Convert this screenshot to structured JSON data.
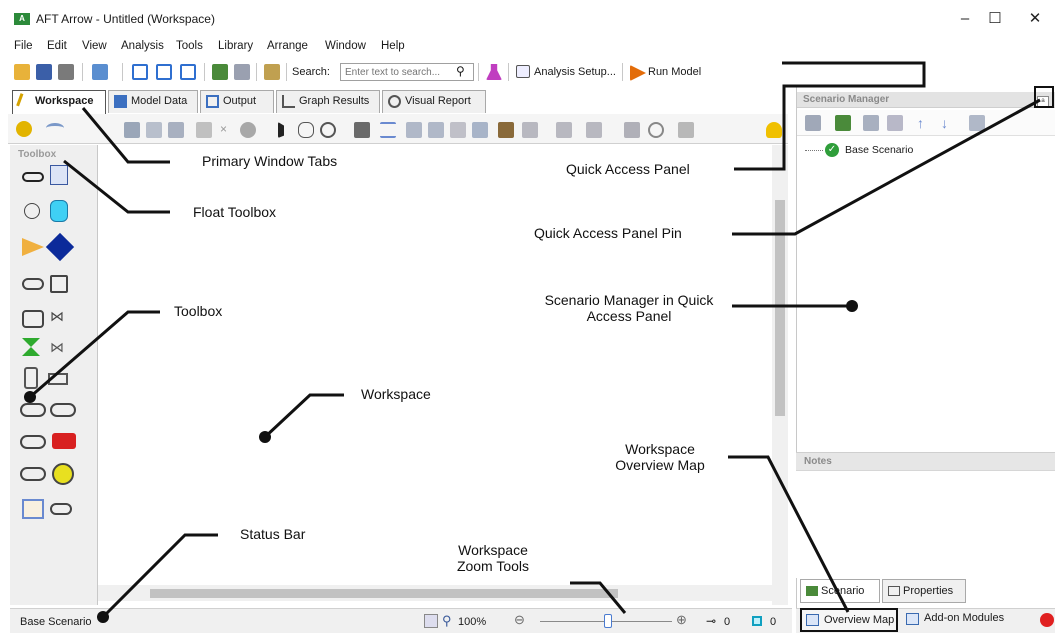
{
  "window": {
    "title": "AFT Arrow - Untitled (Workspace)",
    "app_icon_text": "A",
    "controls": [
      "–",
      "☐",
      "✕"
    ]
  },
  "menu": [
    "File",
    "Edit",
    "View",
    "Analysis",
    "Tools",
    "Library",
    "Arrange",
    "Window",
    "Help"
  ],
  "toolbar": {
    "search_label": "Search:",
    "search_placeholder": "Enter text to search...",
    "analysis_setup": "Analysis Setup...",
    "run_model": "Run Model"
  },
  "tabs": [
    {
      "label": "Workspace",
      "icon": "workspace-icon"
    },
    {
      "label": "Model Data",
      "icon": "table-icon"
    },
    {
      "label": "Output",
      "icon": "output-icon"
    },
    {
      "label": "Graph Results",
      "icon": "graph-icon"
    },
    {
      "label": "Visual Report",
      "icon": "eye-icon"
    }
  ],
  "toolbox": {
    "title": "Toolbox"
  },
  "status": {
    "scenario": "Base Scenario",
    "zoom": "100%",
    "pipe_count": "0",
    "junction_count": "0"
  },
  "quick_access": {
    "title": "Scenario Manager",
    "pin": "ª",
    "tree_item": "Base Scenario",
    "notes_title": "Notes",
    "bottom_tabs": [
      "Scenario",
      "Properties"
    ],
    "overview_map": "Overview Map",
    "addon_modules": "Add-on Modules"
  },
  "annotations": {
    "primary_tabs": "Primary Window Tabs",
    "float_toolbox": "Float Toolbox",
    "toolbox": "Toolbox",
    "workspace": "Workspace",
    "status_bar": "Status Bar",
    "zoom_tools_1": "Workspace",
    "zoom_tools_2": "Zoom Tools",
    "quick_access_panel": "Quick Access Panel",
    "qap_pin": "Quick Access Panel Pin",
    "scenario_mgr_1": "Scenario Manager in Quick",
    "scenario_mgr_2": "Access Panel",
    "overview_1": "Workspace",
    "overview_2": "Overview Map"
  }
}
